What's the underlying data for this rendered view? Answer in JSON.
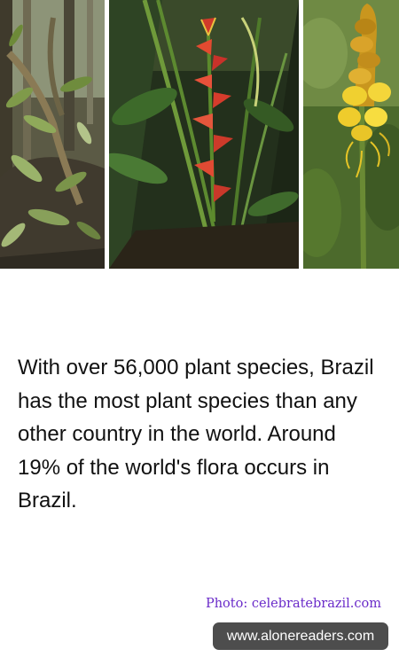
{
  "photos": [
    {
      "icon": "orchid-plant-photo"
    },
    {
      "icon": "heliconia-flower-photo"
    },
    {
      "icon": "yellow-candle-bush-photo"
    }
  ],
  "fact": {
    "text": "With over 56,000 plant species, Brazil has the most plant species than any other country in the world. Around 19% of the world's flora occurs in Brazil."
  },
  "credit": {
    "text": "Photo: celebratebrazil.com",
    "color": "#6a2bc9"
  },
  "watermark": {
    "text": "www.alonereaders.com",
    "background": "#4d4d4d"
  }
}
